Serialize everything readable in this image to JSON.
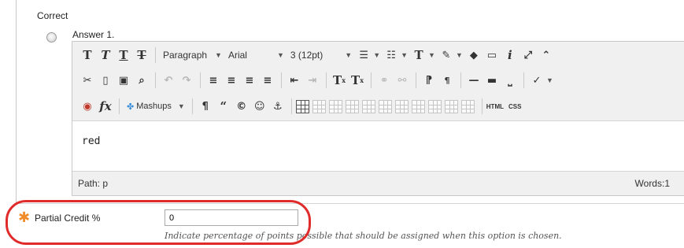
{
  "question": {
    "correct_label": "Correct",
    "answer_label": "Answer 1."
  },
  "toolbar": {
    "row1": {
      "bold": "T",
      "italic": "T",
      "underline": "T",
      "strikethrough": "T",
      "format_select": "Paragraph",
      "font_select": "Arial",
      "size_select": "3 (12pt)",
      "text_color": "T",
      "info": "i"
    },
    "row2": {
      "superscript": "T",
      "subscript": "T",
      "show_blocks": "¶"
    },
    "row3": {
      "mashups": "Mashups",
      "paragraph": "¶",
      "quote": "“",
      "copyright": "©",
      "html": "HTML",
      "css": "CSS"
    }
  },
  "editor": {
    "content": "red",
    "path": "Path: p",
    "words": "Words:1"
  },
  "partial_credit": {
    "label": "Partial Credit %",
    "value": "0",
    "hint": "Indicate percentage of points possible that should be assigned when this option is chosen."
  },
  "colors": {
    "required_star": "#f28c28",
    "highlight": "#e02b2b"
  }
}
